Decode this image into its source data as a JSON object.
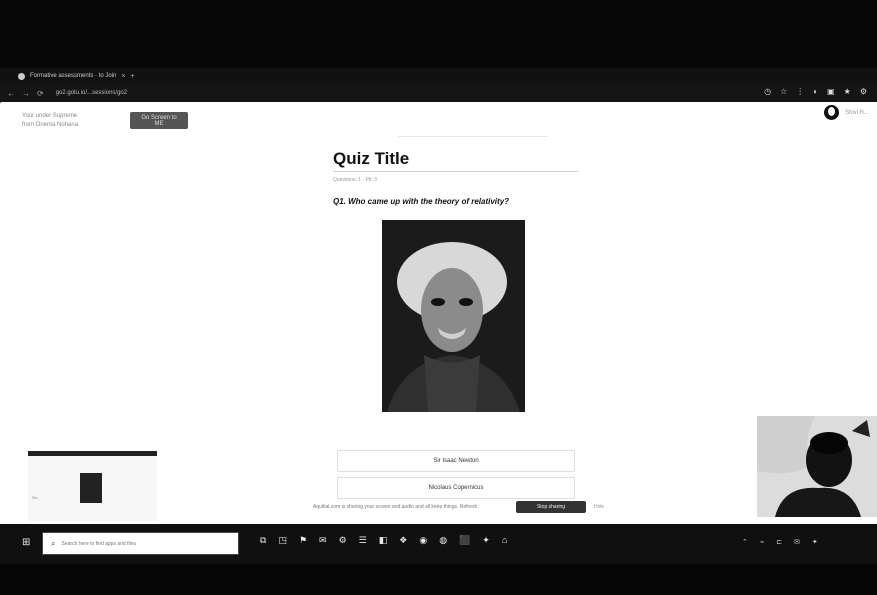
{
  "browser": {
    "tab_title": "Formative assessments · to Join",
    "tab_close": "×",
    "new_tab": "+",
    "url": "go2.gotu.io/...sessions/go2",
    "nav": [
      "←",
      "→",
      "⟳"
    ],
    "toolbar_icons": [
      "◷",
      "☆",
      "⋮",
      "◐",
      "▣",
      "★",
      "⚙"
    ]
  },
  "page": {
    "side_text_1": "Your under Supreme",
    "side_text_2": "from Onenta Nohana",
    "share_button": "Go Screen to ME",
    "user_name": "Shivi R...",
    "quiz_title": "Quiz Title",
    "quiz_meta": "Questions: 1 · Ptl: 3",
    "question": "Q1. Who came up with the theory of relativity?",
    "answers": [
      "Sir Isaac Newton",
      "Nicolaus Copernicus"
    ],
    "share_bar_text": "Aquitial.com is sharing your screen and audio and all keep things. Refresh",
    "stop_sharing": "Stop sharing",
    "hide": "Hide"
  },
  "taskbar": {
    "start": "⊞",
    "search_placeholder": "Search here to find apps and files",
    "icons": [
      "⧉",
      "◳",
      "⚑",
      "✉",
      "⚙",
      "☰",
      "◧",
      "❖",
      "◉",
      "◍",
      "⬛",
      "✦",
      "⌂"
    ],
    "tray": [
      "⌃",
      "⌁",
      "⊏",
      "✉",
      "✦"
    ]
  },
  "preview": {
    "small_text": "Sh..."
  }
}
